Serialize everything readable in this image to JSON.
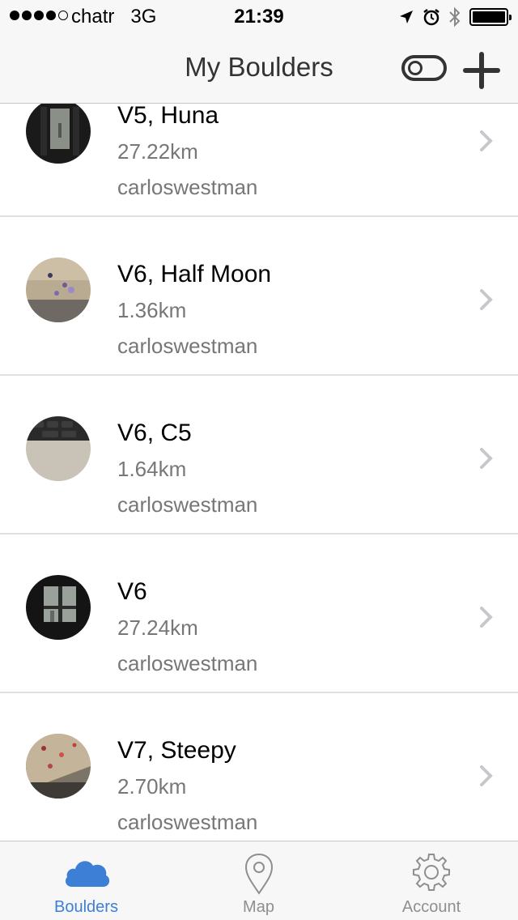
{
  "status_bar": {
    "carrier": "chatr",
    "network": "3G",
    "time": "21:39",
    "signal_bars_filled": 4,
    "signal_bars_total": 5
  },
  "nav": {
    "title": "My Boulders"
  },
  "boulders": [
    {
      "title": "V5, Huna",
      "distance": "27.22km",
      "user": "carloswestman",
      "thumb": "dark-window"
    },
    {
      "title": "V6, Half Moon",
      "distance": "1.36km",
      "user": "carloswestman",
      "thumb": "climbing-wall"
    },
    {
      "title": "V6, C5",
      "distance": "1.64km",
      "user": "carloswestman",
      "thumb": "keyboard"
    },
    {
      "title": "V6",
      "distance": "27.24km",
      "user": "carloswestman",
      "thumb": "dark-window"
    },
    {
      "title": "V7, Steepy",
      "distance": "2.70km",
      "user": "carloswestman",
      "thumb": "steep-wall"
    }
  ],
  "tabs": [
    {
      "label": "Boulders",
      "icon": "cloud-icon",
      "active": true
    },
    {
      "label": "Map",
      "icon": "map-pin-icon",
      "active": false
    },
    {
      "label": "Account",
      "icon": "gear-icon",
      "active": false
    }
  ],
  "colors": {
    "accent": "#3d7fd6",
    "bar_background": "#f7f7f7",
    "secondary_text": "#777777"
  }
}
